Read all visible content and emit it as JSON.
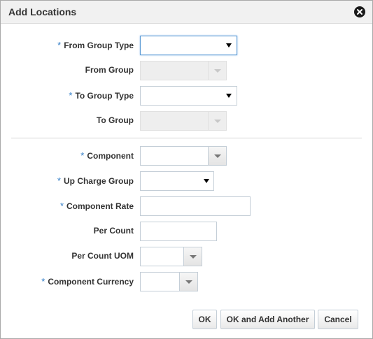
{
  "dialog": {
    "title": "Add Locations",
    "close_icon": "close-icon"
  },
  "required_marker": "*",
  "fields": {
    "from_group_type": {
      "label": "From Group Type",
      "required": true,
      "value": ""
    },
    "from_group": {
      "label": "From Group",
      "required": false,
      "value": "",
      "disabled": true
    },
    "to_group_type": {
      "label": "To Group Type",
      "required": true,
      "value": ""
    },
    "to_group": {
      "label": "To Group",
      "required": false,
      "value": "",
      "disabled": true
    },
    "component": {
      "label": "Component",
      "required": true,
      "value": ""
    },
    "up_charge_group": {
      "label": "Up Charge Group",
      "required": true,
      "value": ""
    },
    "component_rate": {
      "label": "Component Rate",
      "required": true,
      "value": ""
    },
    "per_count": {
      "label": "Per Count",
      "required": false,
      "value": ""
    },
    "per_count_uom": {
      "label": "Per Count UOM",
      "required": false,
      "value": ""
    },
    "component_currency": {
      "label": "Component Currency",
      "required": true,
      "value": ""
    }
  },
  "buttons": {
    "ok": "OK",
    "ok_and_add_another": "OK and Add Another",
    "cancel": "Cancel"
  },
  "colors": {
    "required_marker": "#2e7bc6",
    "focus_border": "#5b9bd5",
    "titlebar": "#f1f1f1"
  }
}
